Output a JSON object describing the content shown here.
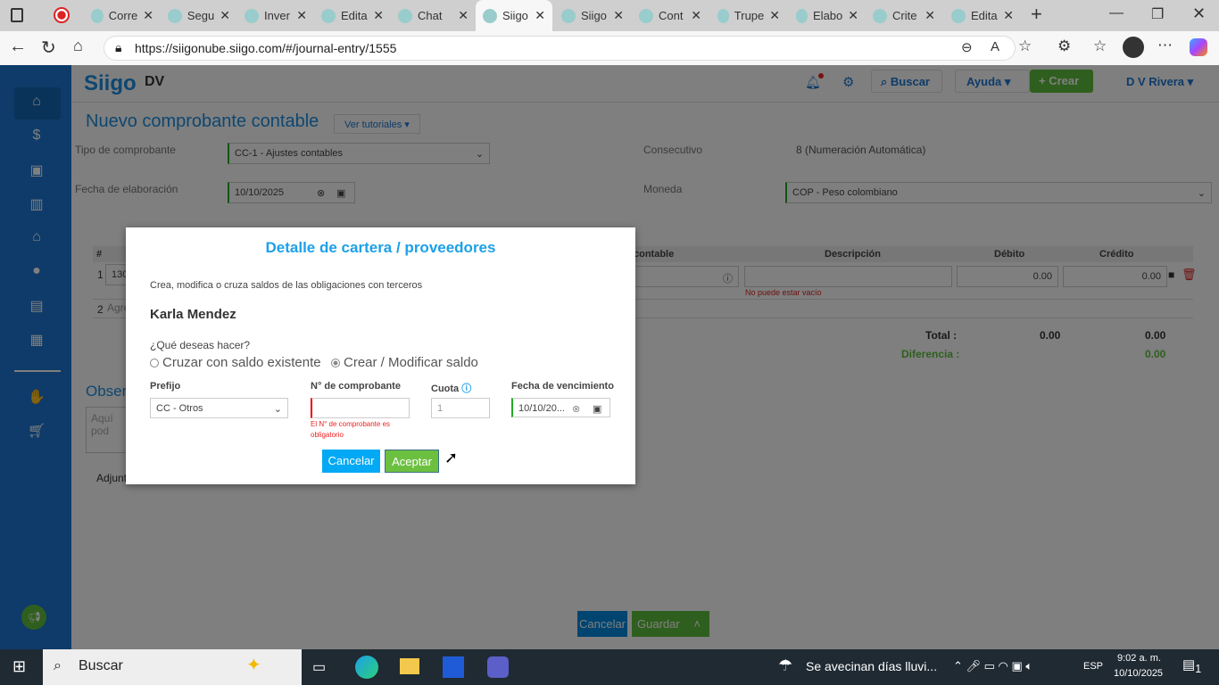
{
  "browser": {
    "tabs": [
      {
        "label": "Corre"
      },
      {
        "label": "Segu"
      },
      {
        "label": "Inver"
      },
      {
        "label": "Edita"
      },
      {
        "label": "Chat"
      },
      {
        "label": "Siigo",
        "active": true
      },
      {
        "label": "Siigo"
      },
      {
        "label": "Cont"
      },
      {
        "label": "Trupe"
      },
      {
        "label": "Elabo"
      },
      {
        "label": "Crite"
      },
      {
        "label": "Edita"
      }
    ],
    "url": "https://siigonube.siigo.com/#/journal-entry/1555"
  },
  "header": {
    "logo": "Siigo",
    "company": "DV",
    "search": "Buscar",
    "help": "Ayuda",
    "create": "Crear",
    "user": "D V Rivera"
  },
  "form": {
    "title": "Nuevo comprobante contable",
    "tutorials": "Ver tutoriales",
    "tipo_label": "Tipo de comprobante",
    "tipo_value": "CC-1 - Ajustes contables",
    "fecha_label": "Fecha de elaboración",
    "fecha_value": "10/10/2025",
    "consecutivo_label": "Consecutivo",
    "consecutivo_value": "8 (Numeración Automática)",
    "moneda_label": "Moneda",
    "moneda_value": "COP - Peso colombiano"
  },
  "table": {
    "headers": {
      "num": "#",
      "cuenta": "contable",
      "descripcion": "Descripción",
      "debito": "Débito",
      "credito": "Crédito"
    },
    "row1": {
      "num": "1",
      "cuenta": "130",
      "debito": "0.00",
      "credito": "0.00",
      "error": "No puede estar vacío"
    },
    "row2": {
      "num": "2",
      "cuenta": "Agre"
    },
    "total_label": "Total :",
    "total_debito": "0.00",
    "total_credito": "0.00",
    "diff_label": "Diferencia :",
    "diff_value": "0.00"
  },
  "observ": {
    "title": "Observ",
    "placeholder": "Aquí pod",
    "adjuntar": "Adjunt"
  },
  "footer": {
    "cancel": "Cancelar",
    "save": "Guardar"
  },
  "modal": {
    "title": "Detalle de cartera / proveedores",
    "subtitle": "Crea, modifica o cruza saldos de las obligaciones con terceros",
    "name": "Karla Mendez",
    "question": "¿Qué deseas hacer?",
    "option1": "Cruzar con saldo existente",
    "option2": "Crear / Modificar saldo",
    "prefijo_label": "Prefijo",
    "prefijo_value": "CC - Otros",
    "num_label": "N° de comprobante",
    "num_value": "",
    "num_error": "El N° de comprobante es obligatorio",
    "cuota_label": "Cuota",
    "cuota_value": "1",
    "venc_label": "Fecha de vencimiento",
    "venc_value": "10/10/20...",
    "cancel": "Cancelar",
    "accept": "Aceptar"
  },
  "taskbar": {
    "search": "Buscar",
    "weather": "Se avecinan días lluvi...",
    "lang": "ESP",
    "time": "9:02 a. m.",
    "date": "10/10/2025",
    "notif": "1"
  }
}
